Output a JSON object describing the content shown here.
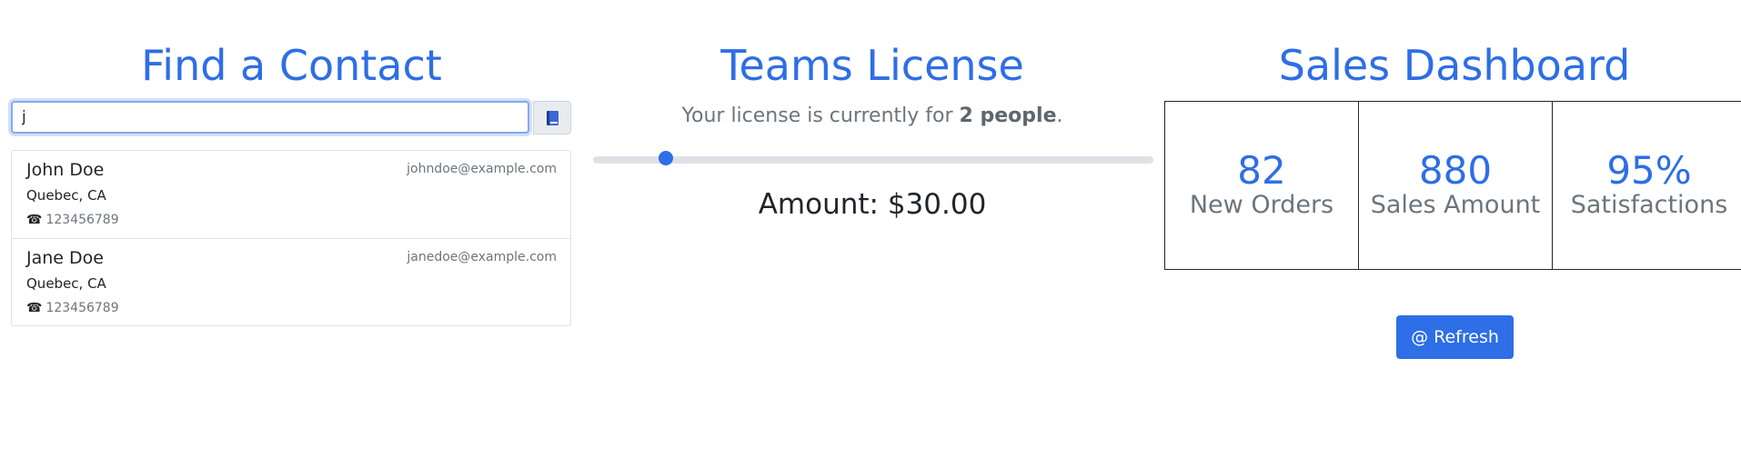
{
  "contacts": {
    "title": "Find a Contact",
    "search_value": "j",
    "book_icon": "address-book-icon",
    "items": [
      {
        "name": "John Doe",
        "email": "johndoe@example.com",
        "city": "Quebec, CA",
        "phone_icon": "☎",
        "phone": "123456789"
      },
      {
        "name": "Jane Doe",
        "email": "janedoe@example.com",
        "city": "Quebec, CA",
        "phone_icon": "☎",
        "phone": "123456789"
      }
    ]
  },
  "license": {
    "title": "Teams License",
    "text_prefix": "Your license is currently for ",
    "people": "2 people",
    "text_suffix": ".",
    "slider_value": 0.12,
    "amount": "Amount: $30.00"
  },
  "dashboard": {
    "title": "Sales Dashboard",
    "stats": [
      {
        "value": "82",
        "label": "New Orders"
      },
      {
        "value": "880",
        "label": "Sales Amount"
      },
      {
        "value": "95%",
        "label": "Satisfactions"
      }
    ],
    "refresh_label": "@ Refresh"
  },
  "colors": {
    "accent": "#2e6ee6",
    "muted_text": "#6c757d",
    "border": "#dfe2e6"
  }
}
